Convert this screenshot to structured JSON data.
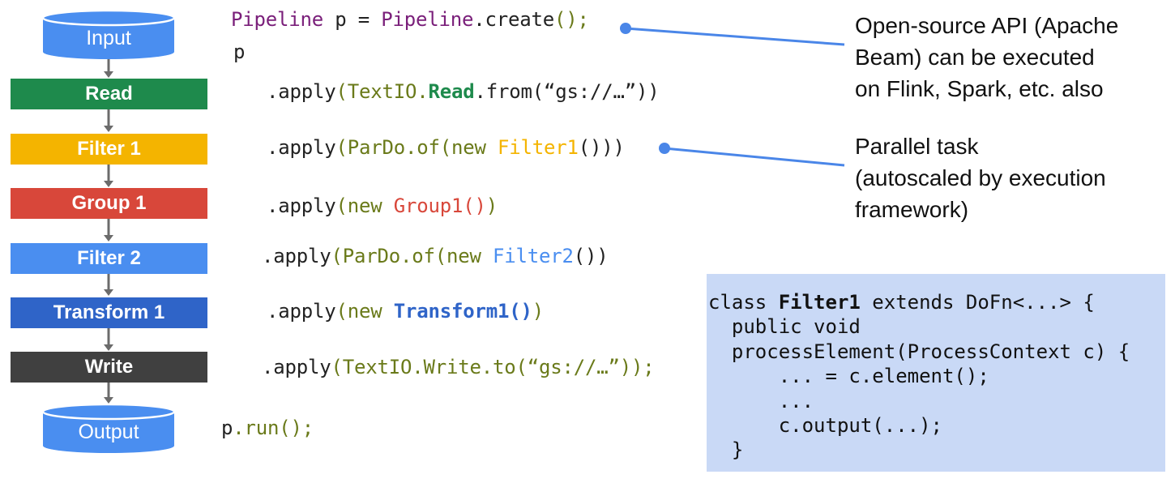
{
  "pipeline": {
    "source": "Input",
    "steps": [
      {
        "label": "Read",
        "color": "#1e8a4c"
      },
      {
        "label": "Filter 1",
        "color": "#f4b400"
      },
      {
        "label": "Group 1",
        "color": "#d8473a"
      },
      {
        "label": "Filter 2",
        "color": "#4a8ef0"
      },
      {
        "label": "Transform 1",
        "color": "#2f64c8"
      },
      {
        "label": "Write",
        "color": "#404040"
      }
    ],
    "sink": "Output",
    "cylinder_color": "#4a8ef0"
  },
  "code": {
    "line1": {
      "a": "Pipeline",
      "b": " p = ",
      "c": "Pipeline",
      "d": ".create",
      "e": "();"
    },
    "line2": "p",
    "line3": {
      "a": ".apply",
      "b": "(TextIO.",
      "c": "Read",
      "d": ".from(“gs://…”))"
    },
    "line4": {
      "a": ".apply",
      "b": "(ParDo.of(new ",
      "c": "Filter1",
      "d": "()))"
    },
    "line5": {
      "a": ".apply",
      "b": "(new ",
      "c": "Group1()",
      "d": ")"
    },
    "line6": {
      "a": ".apply",
      "b": "(ParDo.of(new ",
      "c": "Filter2",
      "d": "())"
    },
    "line7": {
      "a": ".apply",
      "b": "(new ",
      "c": "Transform1()",
      "d": ")"
    },
    "line8": {
      "a": ".apply",
      "b": "(TextIO.Write.to(“gs://…”));"
    },
    "line9": {
      "a": "p",
      "b": ".run();"
    }
  },
  "notes": {
    "api": [
      "Open-source API (Apache",
      "Beam) can be executed",
      "on Flink, Spark, etc. also"
    ],
    "parallel": [
      "Parallel task",
      "(autoscaled by execution",
      "framework)"
    ],
    "connector_color": "#4a86e8"
  },
  "class_box": {
    "line1": {
      "a": "class ",
      "b": "Filter1",
      "c": " extends DoFn<...> {"
    },
    "line2": "  public void",
    "line3": "  processElement(ProcessContext c) {",
    "line4": "      ... = c.element();",
    "line5": "      ...",
    "line6": "      c.output(...);",
    "line7": "  }"
  }
}
